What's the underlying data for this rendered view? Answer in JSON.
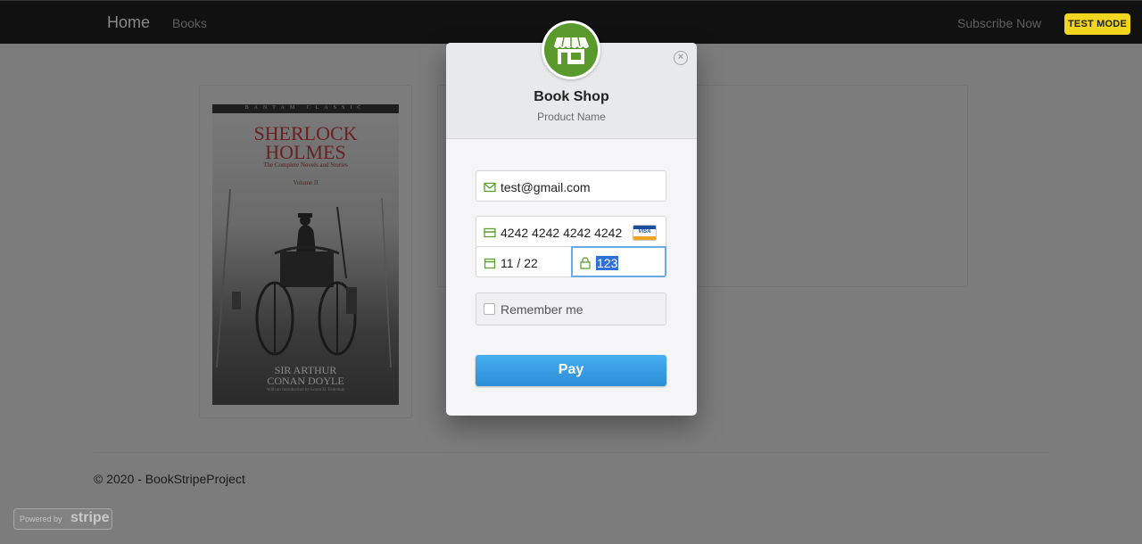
{
  "navbar": {
    "brand": "Home",
    "links": [
      "Books"
    ],
    "subscribe": "Subscribe Now",
    "test_mode_badge": "TEST MODE"
  },
  "book": {
    "cover_series": "BANTAM CLASSIC",
    "cover_title_line1": "SHERLOCK",
    "cover_title_line2": "HOLMES",
    "cover_subtitle": "The Complete Novels and Stories",
    "cover_volume": "Volume II",
    "cover_author_line1": "SIR ARTHUR",
    "cover_author_line2": "CONAN DOYLE",
    "cover_intro": "With an Introduction by Loren D. Estleman"
  },
  "footer": {
    "copyright": "© 2020 - BookStripeProject"
  },
  "powered_badge": {
    "prefix": "Powered by",
    "brand": "stripe"
  },
  "checkout": {
    "shop_name": "Book Shop",
    "product_name": "Product Name",
    "email": "test@gmail.com",
    "card_number": "4242 4242 4242 4242",
    "card_brand": "VISA",
    "expiry": "11 / 22",
    "cvc": "123",
    "remember_label": "Remember me",
    "pay_label": "Pay",
    "accent_color": "#2a8ed6",
    "logo_color": "#5a9a2c"
  }
}
